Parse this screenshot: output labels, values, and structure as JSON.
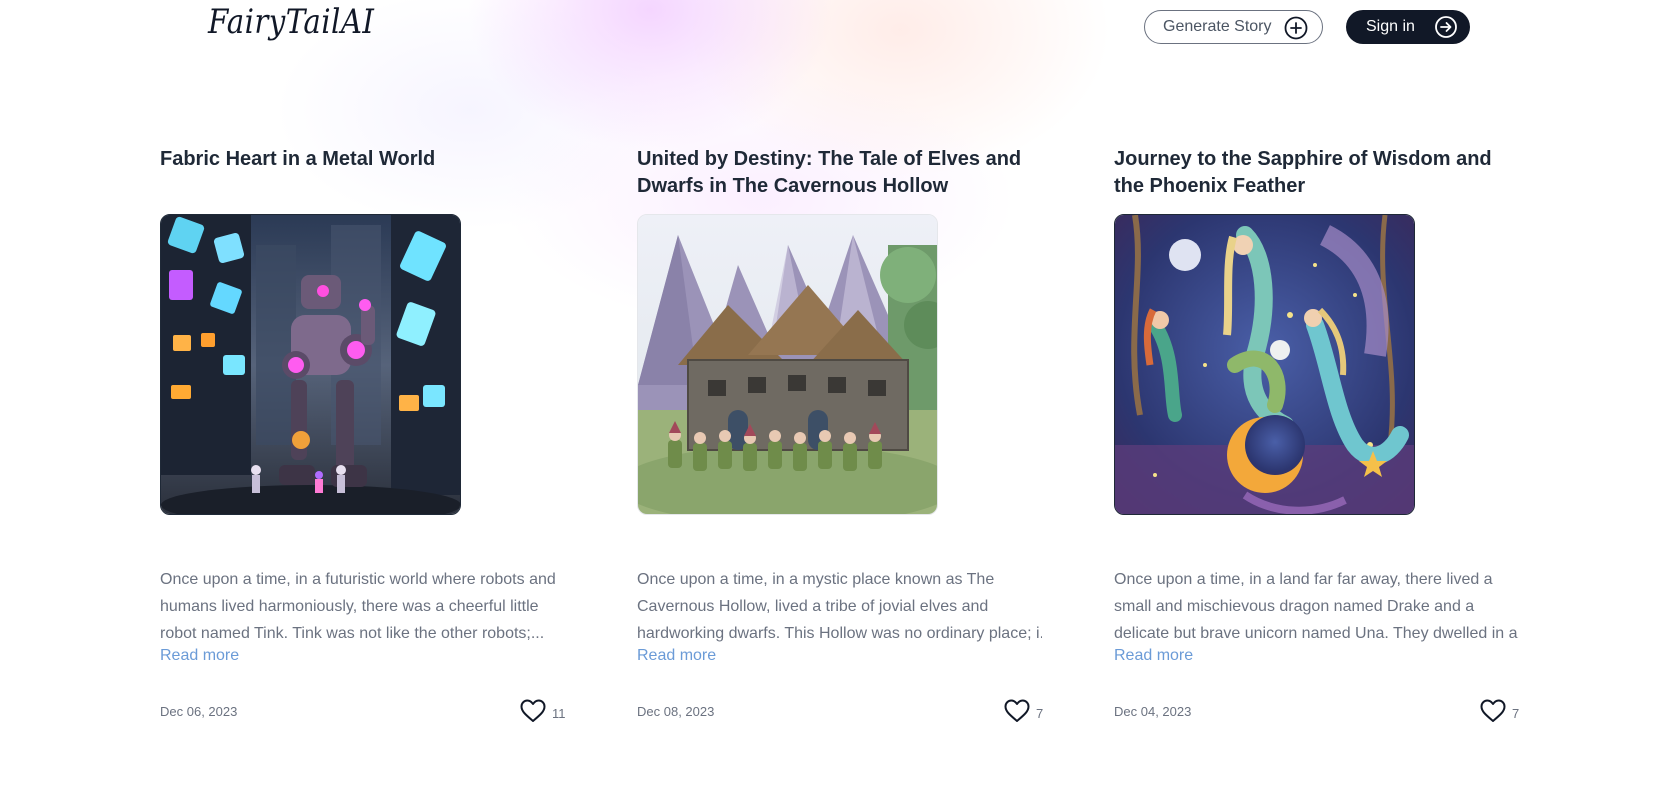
{
  "header": {
    "logo": "FairyTailAI",
    "generate_label": "Generate Story",
    "signin_label": "Sign in"
  },
  "icons": {
    "generate": "plus-circle-icon",
    "signin": "arrow-right-circle-icon",
    "like": "heart-icon"
  },
  "colors": {
    "primary_dark": "#111827",
    "link": "#6b9bd7",
    "muted_text": "#6b7280"
  },
  "stories": [
    {
      "title": "Fabric Heart in a Metal World",
      "excerpt_lines": [
        "Once upon a time, in a futuristic world where robots and",
        "humans lived harmoniously, there was a cheerful little",
        "robot named Tink. Tink was not like the other robots;..."
      ],
      "read_more": "Read more",
      "date": "Dec 06, 2023",
      "likes": "11",
      "image": "robot-city-illustration"
    },
    {
      "title": "United by Destiny: The Tale of Elves and Dwarfs in The Cavernous Hollow",
      "excerpt_lines": [
        "Once upon a time, in a mystic place known as The",
        "Cavernous Hollow, lived a tribe of jovial elves and",
        "hardworking dwarfs. This Hollow was no ordinary place; i..."
      ],
      "read_more": "Read more",
      "date": "Dec 08, 2023",
      "likes": "7",
      "image": "mountain-cottage-dwarfs-illustration"
    },
    {
      "title": "Journey to the Sapphire of Wisdom and the Phoenix Feather",
      "excerpt_lines": [
        "Once upon a time, in a land far far away, there lived a",
        "small and mischievous dragon named Drake and a",
        "delicate but brave unicorn named Una. They dwelled in a..."
      ],
      "read_more": "Read more",
      "date": "Dec 04, 2023",
      "likes": "7",
      "image": "mermaids-unicorn-night-illustration"
    }
  ]
}
